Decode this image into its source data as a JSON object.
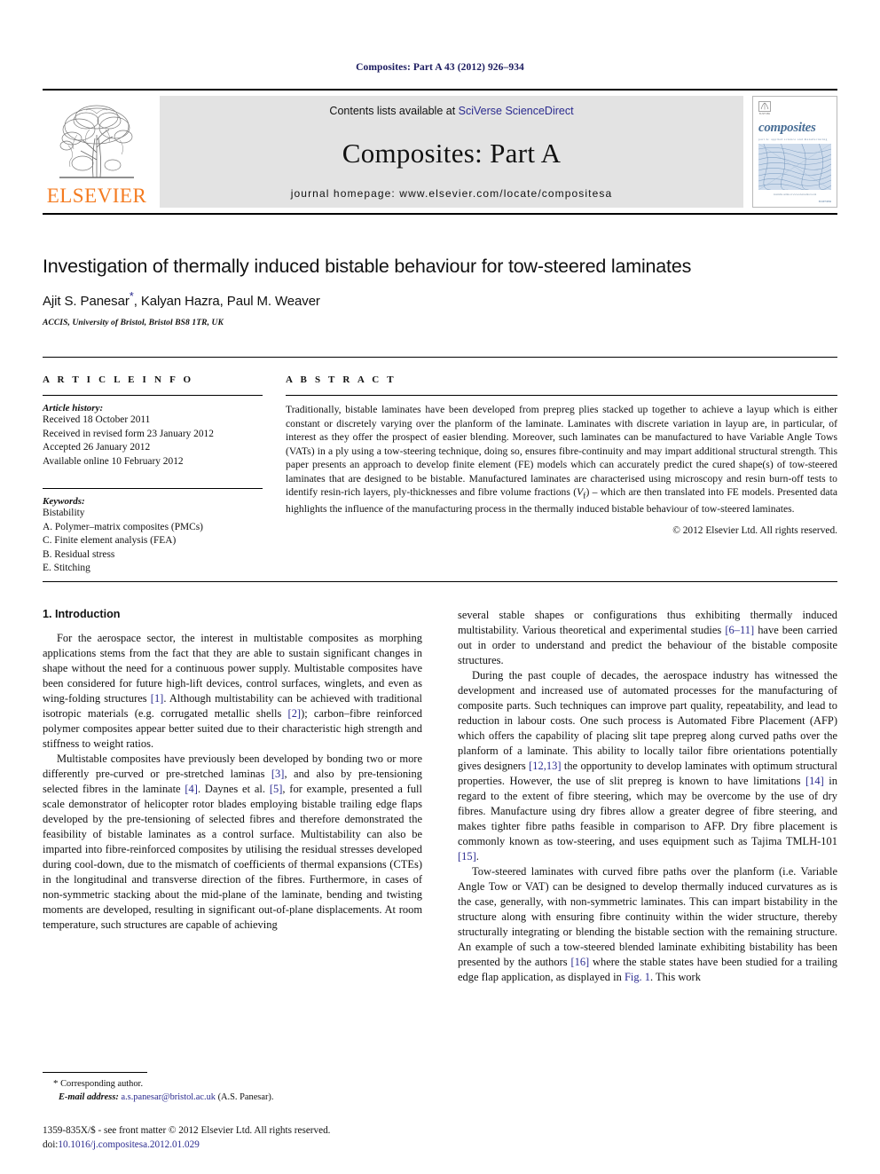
{
  "running_head": "Composites: Part A 43 (2012) 926–934",
  "masthead": {
    "publisher_name": "ELSEVIER",
    "contents_prefix": "Contents lists available at",
    "contents_link": "SciVerse ScienceDirect",
    "journal_title": "Composites: Part A",
    "homepage_label": "journal homepage: www.elsevier.com/locate/compositesa",
    "cover": {
      "wordmark": "composites",
      "subtitle": "part A: applied science and manufacturing",
      "foot_note": "Available online at www.sciencedirect.com",
      "foot_note2": "ELSEVIER"
    }
  },
  "article": {
    "title": "Investigation of thermally induced bistable behaviour for tow-steered laminates",
    "authors": "Ajit S. Panesar",
    "authors_rest": ", Kalyan Hazra, Paul M. Weaver",
    "corresponding_marker": "*",
    "affiliation": "ACCIS, University of Bristol, Bristol BS8 1TR, UK"
  },
  "article_info": {
    "heading": "A R T I C L E   I N F O",
    "history_label": "Article history:",
    "history": [
      "Received 18 October 2011",
      "Received in revised form 23 January 2012",
      "Accepted 26 January 2012",
      "Available online 10 February 2012"
    ],
    "keywords_label": "Keywords:",
    "keywords": [
      "Bistability",
      "A. Polymer–matrix composites (PMCs)",
      "C. Finite element analysis (FEA)",
      "B. Residual stress",
      "E. Stitching"
    ]
  },
  "abstract": {
    "heading": "A B S T R A C T",
    "part1": "Traditionally, bistable laminates have been developed from prepreg plies stacked up together to achieve a layup which is either constant or discretely varying over the planform of the laminate. Laminates with discrete variation in layup are, in particular, of interest as they offer the prospect of easier blending. Moreover, such laminates can be manufactured to have Variable Angle Tows (VATs) in a ply using a tow-steering technique, doing so, ensures fibre-continuity and may impart additional structural strength. This paper presents an approach to develop finite element (FE) models which can accurately predict the cured shape(s) of tow-steered laminates that are designed to be bistable. Manufactured laminates are characterised using microscopy and resin burn-off tests to identify resin-rich layers, ply-thicknesses and fibre volume fractions (",
    "vf_italic": "V",
    "vf_sub": "f",
    "part2": ") – which are then translated into FE models. Presented data highlights the influence of the manufacturing process in the thermally induced bistable behaviour of tow-steered laminates.",
    "copyright": "© 2012 Elsevier Ltd. All rights reserved."
  },
  "introduction": {
    "section_number_title": "1. Introduction",
    "left_paragraphs": [
      {
        "segments": [
          {
            "t": "For the aerospace sector, the interest in multistable composites as morphing applications stems from the fact that they are able to sustain significant changes in shape without the need for a continuous power supply. Multistable composites have been considered for future high-lift devices, control surfaces, winglets, and even as wing-folding structures "
          },
          {
            "t": "[1]",
            "style": "ref"
          },
          {
            "t": ". Although multistability can be achieved with traditional isotropic materials (e.g. corrugated metallic shells "
          },
          {
            "t": "[2]",
            "style": "ref"
          },
          {
            "t": "); carbon–fibre reinforced polymer composites appear better suited due to their characteristic high strength and stiffness to weight ratios."
          }
        ]
      },
      {
        "segments": [
          {
            "t": "Multistable composites have previously been developed by bonding two or more differently pre-curved or pre-stretched laminas "
          },
          {
            "t": "[3]",
            "style": "ref"
          },
          {
            "t": ", and also by pre-tensioning selected fibres in the laminate "
          },
          {
            "t": "[4]",
            "style": "ref"
          },
          {
            "t": ". Daynes et al. "
          },
          {
            "t": "[5]",
            "style": "ref"
          },
          {
            "t": ", for example, presented a full scale demonstrator of helicopter rotor blades employing bistable trailing edge flaps developed by the pre-tensioning of selected fibres and therefore demonstrated the feasibility of bistable laminates as a control surface. Multistability can also be imparted into fibre-reinforced composites by utilising the residual stresses developed during cool-down, due to the mismatch of coefficients of thermal expansions (CTEs) in the longitudinal and transverse direction of the fibres. Furthermore, in cases of non-symmetric stacking about the mid-plane of the laminate, bending and twisting moments are developed, resulting in significant out-of-plane displacements. At room temperature, such structures are capable of achieving"
          }
        ]
      }
    ],
    "right_paragraphs": [
      {
        "no_indent": true,
        "segments": [
          {
            "t": "several stable shapes or configurations thus exhibiting thermally induced multistability. Various theoretical and experimental studies "
          },
          {
            "t": "[6–11]",
            "style": "ref"
          },
          {
            "t": " have been carried out in order to understand and predict the behaviour of the bistable composite structures."
          }
        ]
      },
      {
        "segments": [
          {
            "t": "During the past couple of decades, the aerospace industry has witnessed the development and increased use of automated processes for the manufacturing of composite parts. Such techniques can improve part quality, repeatability, and lead to reduction in labour costs. One such process is Automated Fibre Placement (AFP) which offers the capability of placing slit tape prepreg along curved paths over the planform of a laminate. This ability to locally tailor fibre orientations potentially gives designers "
          },
          {
            "t": "[12,13]",
            "style": "ref"
          },
          {
            "t": " the opportunity to develop laminates with optimum structural properties. However, the use of slit prepreg is known to have limitations "
          },
          {
            "t": "[14]",
            "style": "ref"
          },
          {
            "t": " in regard to the extent of fibre steering, which may be overcome by the use of dry fibres. Manufacture using dry fibres allow a greater degree of fibre steering, and makes tighter fibre paths feasible in comparison to AFP. Dry fibre placement is commonly known as tow-steering, and uses equipment such as Tajima TMLH-101 "
          },
          {
            "t": "[15]",
            "style": "ref"
          },
          {
            "t": "."
          }
        ]
      },
      {
        "segments": [
          {
            "t": "Tow-steered laminates with curved fibre paths over the planform (i.e. Variable Angle Tow or VAT) can be designed to develop thermally induced curvatures as is the case, generally, with non-symmetric laminates. This can impart bistability in the structure along with ensuring fibre continuity within the wider structure, thereby structurally integrating or blending the bistable section with the remaining structure. An example of such a tow-steered blended laminate exhibiting bistability has been presented by the authors "
          },
          {
            "t": "[16]",
            "style": "ref"
          },
          {
            "t": " where the stable states have been studied for a trailing edge flap application, as displayed in "
          },
          {
            "t": "Fig. 1",
            "style": "figref"
          },
          {
            "t": ". This work"
          }
        ]
      }
    ]
  },
  "footnote": {
    "corresponding_marker": "*",
    "corresponding_text": "Corresponding author.",
    "email_label": "E-mail address:",
    "email": "a.s.panesar@bristol.ac.uk",
    "email_owner": "(A.S. Panesar)."
  },
  "page_footer": {
    "issn_line": "1359-835X/$ - see front matter © 2012 Elsevier Ltd. All rights reserved.",
    "doi_label": "doi:",
    "doi_value": "10.1016/j.compositesa.2012.01.029"
  },
  "colors": {
    "link": "#2b2b8f",
    "elsevier_orange": "#F47B20",
    "masthead_grey": "#e3e3e3",
    "running_head": "#1a1a5e"
  }
}
